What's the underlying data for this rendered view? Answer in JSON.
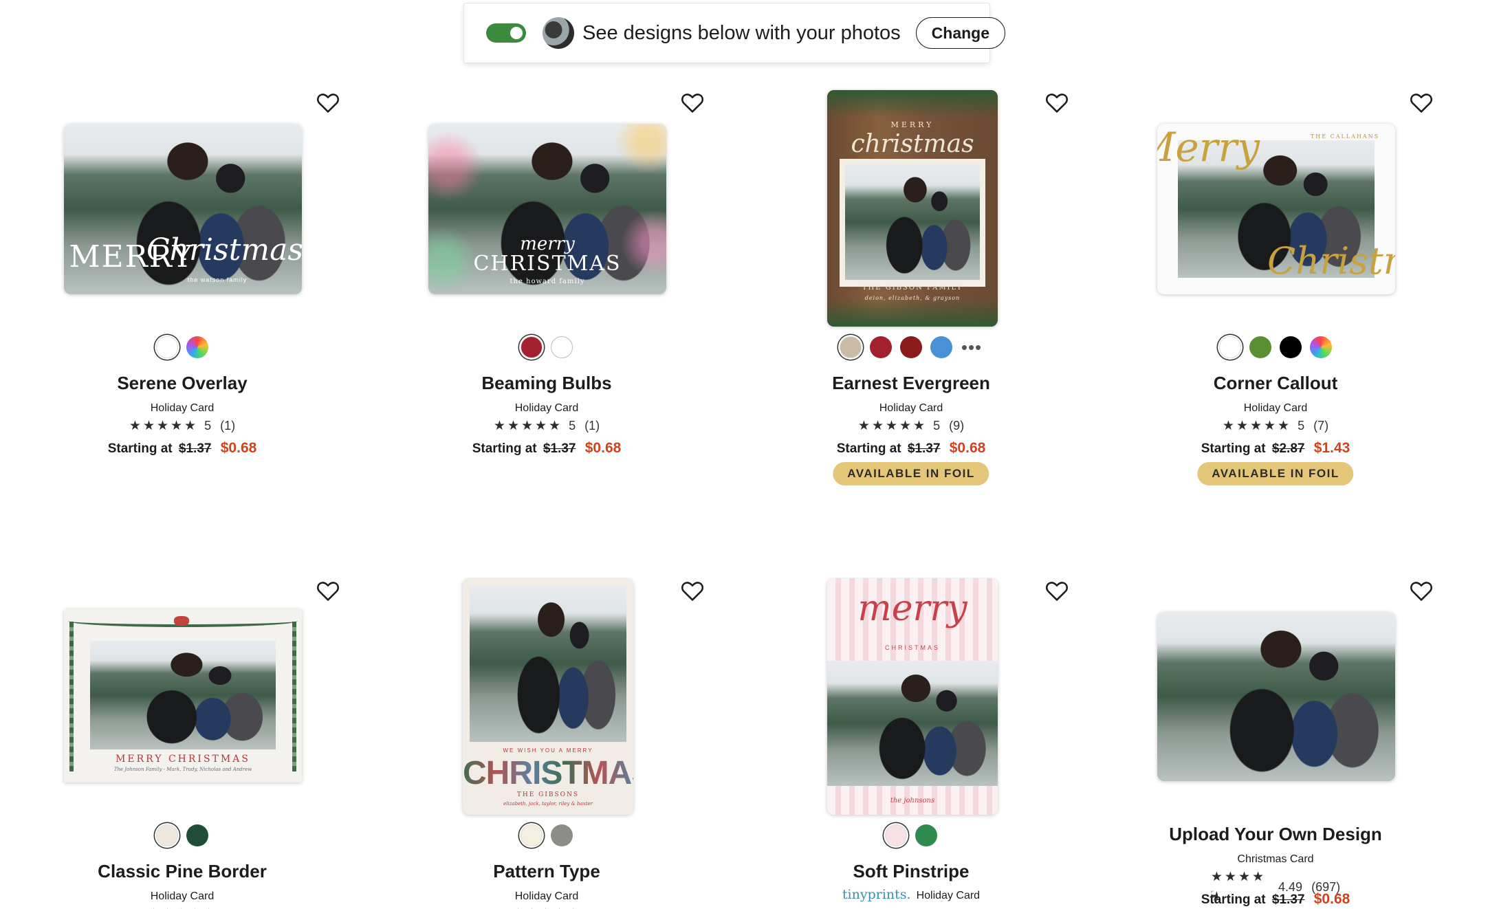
{
  "photo_bar": {
    "text": "See designs below with your photos",
    "change_label": "Change",
    "toggle_on": true
  },
  "products": [
    {
      "name": "Serene Overlay",
      "type": "Holiday Card",
      "rating": "5",
      "review_count": "(1)",
      "price_prefix": "Starting at",
      "old_price": "$1.37",
      "new_price": "$0.68",
      "card_lines": [
        "MERRY",
        "Christmas",
        "the watson family"
      ],
      "swatches": [
        "#ffffff",
        "rainbow"
      ],
      "foil": null
    },
    {
      "name": "Beaming Bulbs",
      "type": "Holiday Card",
      "rating": "5",
      "review_count": "(1)",
      "price_prefix": "Starting at",
      "old_price": "$1.37",
      "new_price": "$0.68",
      "card_lines": [
        "merry",
        "CHRISTMAS",
        "the howard family"
      ],
      "swatches": [
        "#a3212f",
        "#ffffff"
      ],
      "foil": null
    },
    {
      "name": "Earnest Evergreen",
      "type": "Holiday Card",
      "rating": "5",
      "review_count": "(9)",
      "price_prefix": "Starting at",
      "old_price": "$1.37",
      "new_price": "$0.68",
      "card_lines": [
        "MERRY",
        "christmas",
        "THE GIBSON FAMILY",
        "deion, elizabeth, & grayson"
      ],
      "swatches": [
        "#c9bba6",
        "#a3212f",
        "#8b1a1a",
        "#4a90d6",
        "more"
      ],
      "foil": "AVAILABLE IN FOIL"
    },
    {
      "name": "Corner Callout",
      "type": "Holiday Card",
      "rating": "5",
      "review_count": "(7)",
      "price_prefix": "Starting at",
      "old_price": "$2.87",
      "new_price": "$1.43",
      "card_lines": [
        "Merry",
        "Christmas",
        "THE CALLAHANS"
      ],
      "swatches": [
        "#ffffff",
        "#5a8f32",
        "#000000",
        "rainbow"
      ],
      "foil": "AVAILABLE IN FOIL"
    },
    {
      "name": "Classic Pine Border",
      "type": "Holiday Card",
      "rating": "",
      "review_count": "",
      "card_lines": [
        "MERRY CHRISTMAS",
        "The Johnson Family - Mark, Trudy, Nicholas and Andrew"
      ],
      "swatches": [
        "#efe6dc",
        "#1f4d37"
      ],
      "foil": null
    },
    {
      "name": "Pattern Type",
      "type": "Holiday Card",
      "rating": "",
      "review_count": "",
      "card_lines": [
        "WE WISH YOU A MERRY",
        "CHRISTMAS",
        "THE GIBSONS",
        "elizabeth, jack, taylor, riley & baxter"
      ],
      "swatches": [
        "#f4efe1",
        "#8c8c88"
      ],
      "foil": null
    },
    {
      "name": "Soft Pinstripe",
      "brand": "tinyprints.",
      "type": "Holiday Card",
      "rating": "",
      "review_count": "",
      "card_lines": [
        "merry",
        "CHRISTMAS",
        "the johnsons"
      ],
      "swatches": [
        "#f7e1e4",
        "#2e8a4e"
      ],
      "foil": null
    },
    {
      "name": "Upload Your Own Design",
      "type": "Christmas Card",
      "rating": "4.49",
      "review_count": "(697)",
      "price_prefix": "Starting at",
      "old_price": "$1.37",
      "new_price": "$0.68",
      "card_lines": [],
      "swatches": [],
      "foil": null
    }
  ]
}
